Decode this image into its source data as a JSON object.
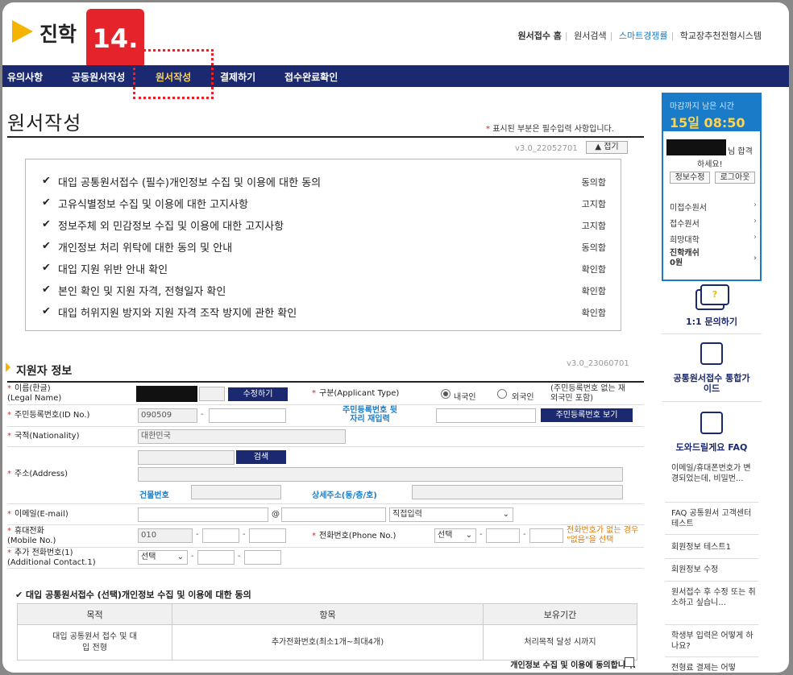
{
  "header": {
    "logo_text": "진학",
    "step_badge": "14.",
    "toplinks": [
      "원서접수 홈",
      "원서검색",
      "스마트경쟁률",
      "학교장추천전형시스템"
    ]
  },
  "nav": {
    "items": [
      "유의사항",
      "공동원서작성",
      "원서작성",
      "결제하기",
      "접수완료확인"
    ],
    "active_index": 2
  },
  "page": {
    "title": "원서작성",
    "required_note": "표시된 부분은 필수입력 사항입니다.",
    "required_star": "*",
    "version1": "v3.0_22052701",
    "fold_button": "▲ 접기"
  },
  "consents": [
    {
      "text": "대입 공통원서접수 (필수)개인정보 수집 및 이용에 대한 동의",
      "status": "동의함"
    },
    {
      "text": "고유식별정보 수집 및 이용에 대한 고지사항",
      "status": "고지함"
    },
    {
      "text": "정보주체 외 민감정보 수집 및 이용에 대한 고지사항",
      "status": "고지함"
    },
    {
      "text": "개인정보 처리 위탁에 대한 동의 및 안내",
      "status": "동의함"
    },
    {
      "text": "대입 지원 위반 안내 확인",
      "status": "확인함"
    },
    {
      "text": "본인 확인 및 지원 자격, 전형일자 확인",
      "status": "확인함"
    },
    {
      "text": "대입 허위지원 방지와 지원 자격 조작 방지에 관한 확인",
      "status": "확인함"
    }
  ],
  "applicant": {
    "section_title": "지원자 정보",
    "version2": "v3.0_23060701",
    "name_label": "이름(한글)",
    "name_label_en": "(Legal Name)",
    "edit_button": "수정하기",
    "type_label": "구분",
    "type_label_en": "(Applicant Type)",
    "type_domestic": "내국인",
    "type_foreign": "외국인",
    "type_note": "(주민등록번호 없는 재외국민 포함)",
    "id_label": "주민등록번호(ID No.)",
    "id_front": "090509",
    "id_back_hint": "주민등록번호 뒷자리 재입력",
    "id_view_button": "주민등록번호 보기",
    "nationality_label": "국적(Nationality)",
    "nationality_value": "대한민국",
    "address_label": "주소(Address)",
    "search_button": "검색",
    "building_no_label": "건물번호",
    "detail_address_label": "상세주소(동/층/호)",
    "email_label": "이메일(E-mail)",
    "email_at": "@",
    "email_domain_select": "직접입력",
    "mobile_label": "휴대전화",
    "mobile_label_en": "(Mobile No.)",
    "mobile_prefix": "010",
    "phone_label": "전화번호(Phone No.)",
    "phone_select": "선택",
    "phone_note": "전화번호가 없는 경우 \"없음\"을 선택",
    "extra_label": "추가 전화번호(1)",
    "extra_label_en": "(Additional Contact.1)",
    "extra_select": "선택"
  },
  "optional_consent": {
    "title": "대입 공통원서접수 (선택)개인정보 수집 및 이용에 대한 동의",
    "headers": [
      "목적",
      "항목",
      "보유기간"
    ],
    "row": [
      "대입 공통원서 접수 및 대입 전형",
      "추가전화번호(최소1개~최대4개)",
      "처리목적 달성 시까지"
    ],
    "agree_text": "개인정보 수집 및 이용에 동의합니다."
  },
  "sidebar": {
    "timer_label": "마감까지 남은 시간",
    "timer_value": "15일 08:50",
    "user_suffix": "님 합격",
    "user_greet": "하세요!",
    "edit_info": "정보수정",
    "logout": "로그아웃",
    "menu": [
      "미접수원서",
      "접수원서",
      "희망대학"
    ],
    "cash_label": "진학캐쉬",
    "cash_value": "0원",
    "inquiry": "1:1 문의하기",
    "guide": "공통원서접수 통합가이드",
    "faq_title": "도와드릴게요 FAQ",
    "faq_items": [
      "이메일/휴대폰번호가 변경되었는데, 비밀번...",
      "FAQ 공통원서 고객센터 테스트",
      "회원정보 테스트1",
      "회원정보 수정",
      "원서접수 후 수정 또는 취소하고 싶습니...",
      "학생부 입력은 어떻게 하나요?",
      "전형료 결제는 어떻"
    ]
  }
}
